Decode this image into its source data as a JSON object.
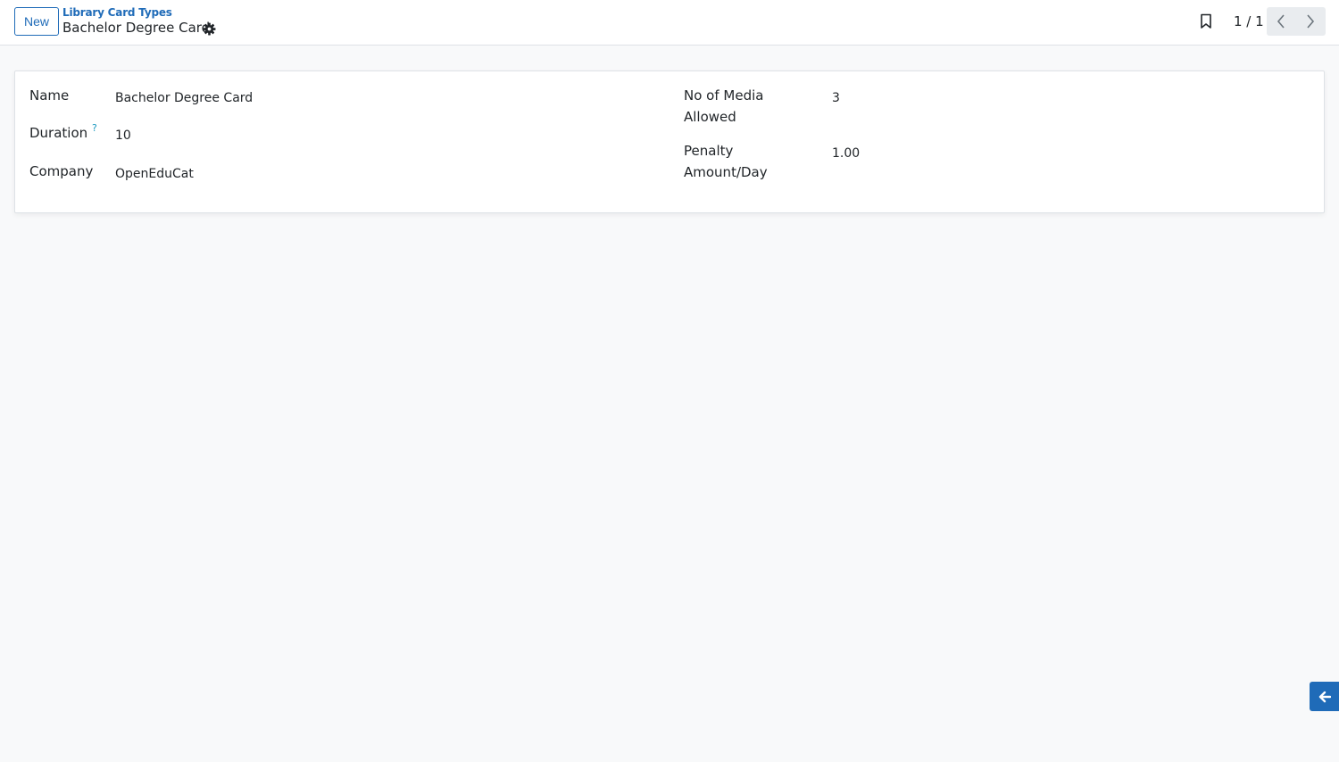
{
  "control_panel": {
    "new_button_label": "New",
    "breadcrumb_parent": "Library Card Types",
    "record_title": "Bachelor Degree Card",
    "pager_value": "1 / 1",
    "icons": [
      "gear-icon",
      "bookmark-icon",
      "chevron-left-icon",
      "chevron-right-icon"
    ]
  },
  "form": {
    "left": [
      {
        "label": "Name",
        "value": "Bachelor Degree Card"
      },
      {
        "label": "Duration",
        "help": "?",
        "value": "10"
      },
      {
        "label": "Company",
        "value": "OpenEduCat"
      }
    ],
    "right": [
      {
        "label_line1": "No of Media",
        "label_line2": "Allowed",
        "value": "3"
      },
      {
        "label_line1": "Penalty",
        "label_line2": "Amount/Day",
        "value": "1.00"
      }
    ]
  },
  "side_toggle": {
    "icon": "arrow-left-icon"
  },
  "colors": {
    "accent": "#1f6bb8",
    "help": "#1f9ac0",
    "background": "#f8f9fa",
    "pager_button": "#e9ecef"
  }
}
